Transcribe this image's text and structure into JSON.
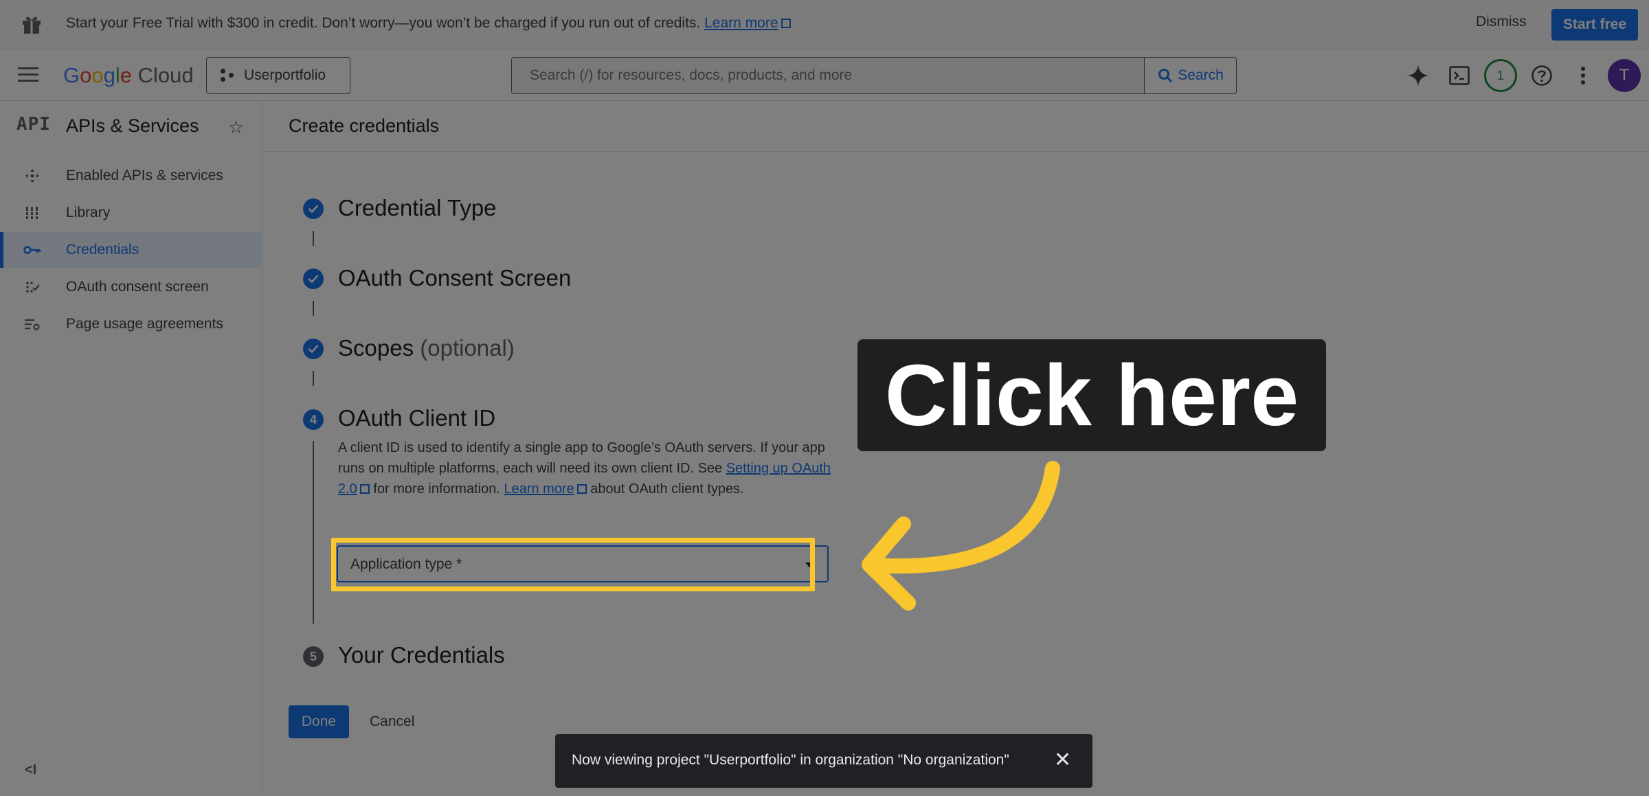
{
  "banner": {
    "message": "Start your Free Trial with $300 in credit. Don’t worry—you won’t be charged if you run out of credits.",
    "learn_more": "Learn more",
    "dismiss": "Dismiss",
    "start_free": "Start free"
  },
  "header": {
    "logo_google": "Google",
    "logo_cloud": "Cloud",
    "project": "Userportfolio",
    "search_placeholder": "Search (/) for resources, docs, products, and more",
    "search_button": "Search",
    "notification_count": "1",
    "avatar_letter": "T"
  },
  "sidebar": {
    "api_badge": "API",
    "title": "APIs & Services",
    "items": [
      {
        "label": "Enabled APIs & services",
        "icon": "enabled-apis-icon"
      },
      {
        "label": "Library",
        "icon": "library-icon"
      },
      {
        "label": "Credentials",
        "icon": "key-icon"
      },
      {
        "label": "OAuth consent screen",
        "icon": "consent-icon"
      },
      {
        "label": "Page usage agreements",
        "icon": "settings-list-icon"
      }
    ],
    "active_index": 2,
    "collapse": "<I"
  },
  "main": {
    "page_title": "Create credentials",
    "steps": [
      {
        "title": "Credential Type",
        "status": "done"
      },
      {
        "title": "OAuth Consent Screen",
        "status": "done"
      },
      {
        "title": "Scopes",
        "optional": "(optional)",
        "status": "done"
      },
      {
        "number": "4",
        "title": "OAuth Client ID",
        "status": "current"
      },
      {
        "number": "5",
        "title": "Your Credentials",
        "status": "todo"
      }
    ],
    "description": {
      "part1": "A client ID is used to identify a single app to Google’s OAuth servers. If your app runs on multiple platforms, each will need its own client ID. See ",
      "link1": "Setting up OAuth 2.0",
      "part2": " for more information. ",
      "link2": "Learn more",
      "part3": " about OAuth client types."
    },
    "application_type_label": "Application type *",
    "done": "Done",
    "cancel": "Cancel"
  },
  "callout": {
    "text": "Click here",
    "color": "#f9c72d"
  },
  "snackbar": {
    "message": "Now viewing project \"Userportfolio\" in organization \"No organization\"",
    "close": "✕"
  },
  "colors": {
    "accent": "#1a73e8",
    "highlight": "#f9c72d"
  }
}
